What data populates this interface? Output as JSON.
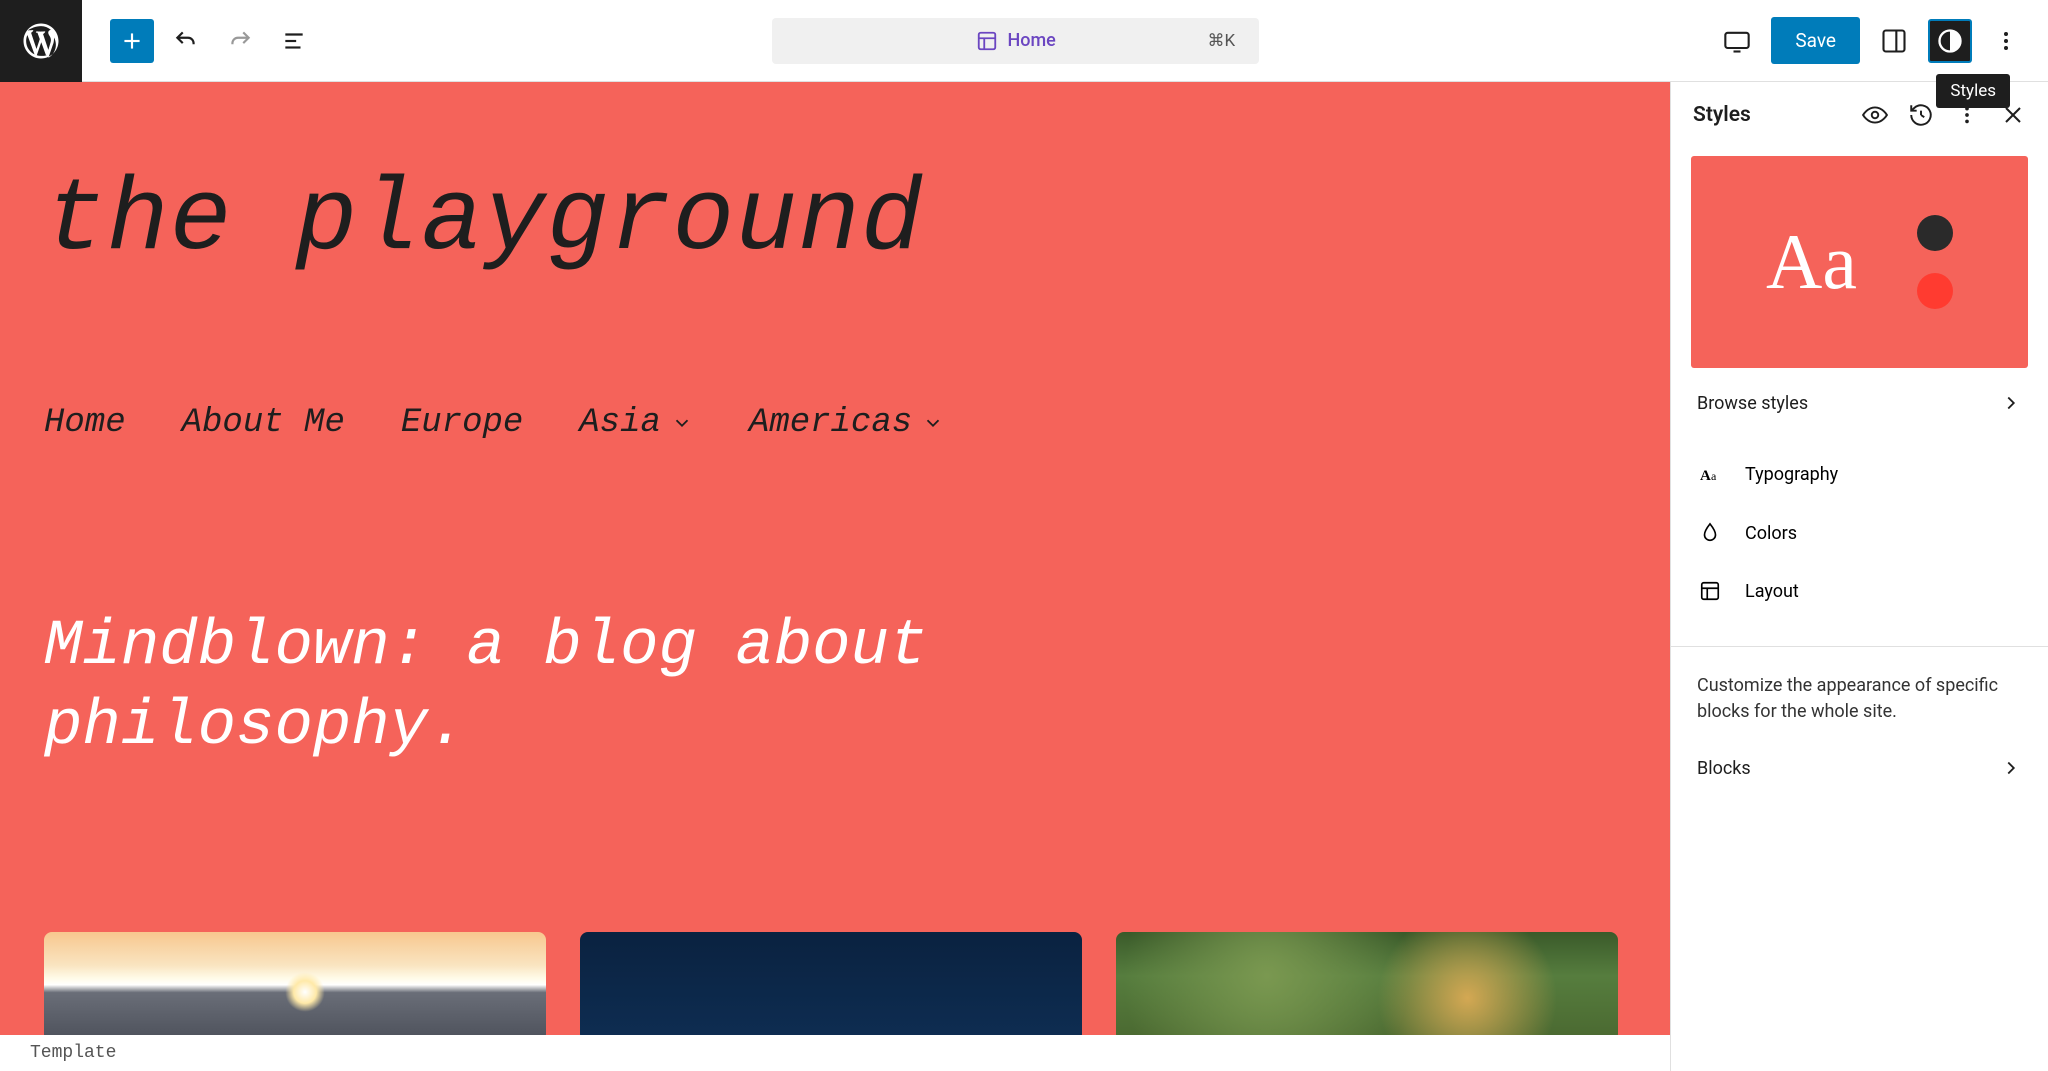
{
  "topbar": {
    "template_label": "Home",
    "shortcut": "⌘K",
    "save_label": "Save",
    "tooltip": "Styles"
  },
  "canvas": {
    "site_title": "the playground",
    "nav": {
      "items": [
        {
          "label": "Home",
          "has_submenu": false
        },
        {
          "label": "About Me",
          "has_submenu": false
        },
        {
          "label": "Europe",
          "has_submenu": false
        },
        {
          "label": "Asia",
          "has_submenu": true
        },
        {
          "label": "Americas",
          "has_submenu": true
        }
      ]
    },
    "tagline": "Mindblown: a blog about philosophy."
  },
  "footer": {
    "breadcrumb": "Template"
  },
  "sidebar": {
    "title": "Styles",
    "preview_text": "Aa",
    "browse_label": "Browse styles",
    "list": [
      {
        "label": "Typography"
      },
      {
        "label": "Colors"
      },
      {
        "label": "Layout"
      }
    ],
    "desc": "Customize the appearance of specific blocks for the whole site.",
    "blocks_label": "Blocks"
  }
}
